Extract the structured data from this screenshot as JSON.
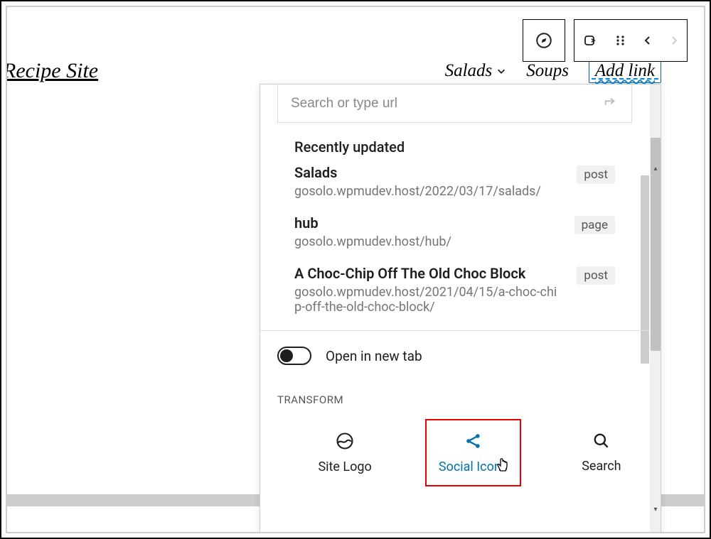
{
  "header": {
    "site_title": " Recipe Site",
    "nav_items": [
      "Salads",
      "Soups"
    ],
    "add_link_label": "Add link"
  },
  "popover": {
    "search_placeholder": "Search or type url",
    "recently_updated_label": "Recently updated",
    "results": [
      {
        "title": "Salads",
        "url": "gosolo.wpmudev.host/2022/03/17/salads/",
        "kind": "post"
      },
      {
        "title": "hub",
        "url": "gosolo.wpmudev.host/hub/",
        "kind": "page"
      },
      {
        "title": "A Choc-Chip Off The Old Choc Block",
        "url": "gosolo.wpmudev.host/2021/04/15/a-choc-chip-off-the-old-choc-block/",
        "kind": "post"
      }
    ],
    "open_new_tab_label": "Open in new tab",
    "transform_label": "TRANSFORM",
    "transform_items": [
      {
        "label": "Site Logo"
      },
      {
        "label": "Social Icons"
      },
      {
        "label": "Search"
      }
    ]
  }
}
